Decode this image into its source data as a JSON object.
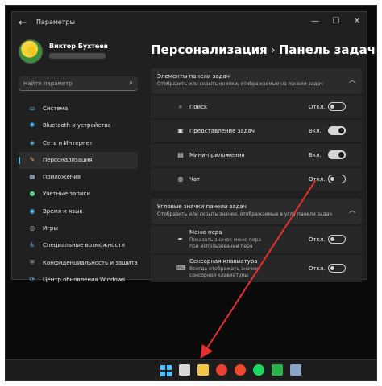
{
  "window": {
    "app_title": "Параметры",
    "back_icon": "arrow-left-icon",
    "controls": [
      "—",
      "☐",
      "✕"
    ]
  },
  "user": {
    "name": "Виктор Бухтеев"
  },
  "search": {
    "placeholder": "Найти параметр"
  },
  "sidebar": {
    "items": [
      {
        "label": "Система",
        "icon": "monitor-icon",
        "color": "#4cc2ff",
        "glyph": "▭"
      },
      {
        "label": "Bluetooth и устройства",
        "icon": "bluetooth-icon",
        "color": "#4cc2ff",
        "glyph": "✱"
      },
      {
        "label": "Сеть и Интернет",
        "icon": "wifi-icon",
        "color": "#4cc2ff",
        "glyph": "◈"
      },
      {
        "label": "Персонализация",
        "icon": "brush-icon",
        "color": "#f0a25c",
        "glyph": "✎"
      },
      {
        "label": "Приложения",
        "icon": "apps-icon",
        "color": "#9fb6d8",
        "glyph": "▦"
      },
      {
        "label": "Учетные записи",
        "icon": "person-icon",
        "color": "#5bd08a",
        "glyph": "●"
      },
      {
        "label": "Время и язык",
        "icon": "globe-clock-icon",
        "color": "#4cc2ff",
        "glyph": "◉"
      },
      {
        "label": "Игры",
        "icon": "gamepad-icon",
        "color": "#b0b0b0",
        "glyph": "◎"
      },
      {
        "label": "Специальные возможности",
        "icon": "accessibility-icon",
        "color": "#6fb8ff",
        "glyph": "♿"
      },
      {
        "label": "Конфиденциальность и защита",
        "icon": "shield-icon",
        "color": "#b0b0b0",
        "glyph": "⛨"
      },
      {
        "label": "Центр обновления Windows",
        "icon": "update-icon",
        "color": "#4cc2ff",
        "glyph": "⟳"
      }
    ],
    "active_index": 3
  },
  "breadcrumb": {
    "parent": "Персонализация",
    "separator": "›",
    "current": "Панель задач"
  },
  "section1": {
    "title": "Элементы панели задач",
    "subtitle": "Отобразить или скрыть кнопки, отображаемые на панели задач",
    "rows": [
      {
        "label": "Поиск",
        "state": "Откл.",
        "on": false,
        "icon": "search-icon",
        "glyph": "⌕"
      },
      {
        "label": "Представление задач",
        "state": "Вкл.",
        "on": true,
        "icon": "task-view-icon",
        "glyph": "▣"
      },
      {
        "label": "Мини-приложения",
        "state": "Вкл.",
        "on": true,
        "icon": "widgets-icon",
        "glyph": "▤"
      },
      {
        "label": "Чат",
        "state": "Откл.",
        "on": false,
        "icon": "chat-icon",
        "glyph": "◍"
      }
    ]
  },
  "section2": {
    "title": "Угловые значки панели задач",
    "subtitle": "Отобразить или скрыть значки, отображаемые в углу панели задач",
    "rows": [
      {
        "label": "Меню пера",
        "desc1": "Показать значок меню пера",
        "desc2": "при использовании пера",
        "state": "Откл.",
        "on": false,
        "icon": "pen-icon",
        "glyph": "✒"
      },
      {
        "label": "Сенсорная клавиатура",
        "desc1": "Всегда отображать значок",
        "desc2": "сенсорной клавиатуры",
        "state": "Откл.",
        "on": false,
        "icon": "keyboard-icon",
        "glyph": "⌨"
      }
    ]
  },
  "taskbar": {
    "icons": [
      {
        "name": "start-icon",
        "color": "#4cc2ff"
      },
      {
        "name": "task-view-icon",
        "color": "#d8d8d8"
      },
      {
        "name": "file-explorer-icon",
        "color": "#f4c542"
      },
      {
        "name": "chrome-icon",
        "color": "#e94235"
      },
      {
        "name": "yandex-browser-icon",
        "color": "#f2492b"
      },
      {
        "name": "spotify-icon",
        "color": "#1ed760"
      },
      {
        "name": "whatsapp-icon",
        "color": "#2bb34b"
      },
      {
        "name": "settings-icon",
        "color": "#8aa4c8"
      }
    ]
  },
  "colors": {
    "accent": "#4cc2ff",
    "arrow": "#e53030"
  }
}
